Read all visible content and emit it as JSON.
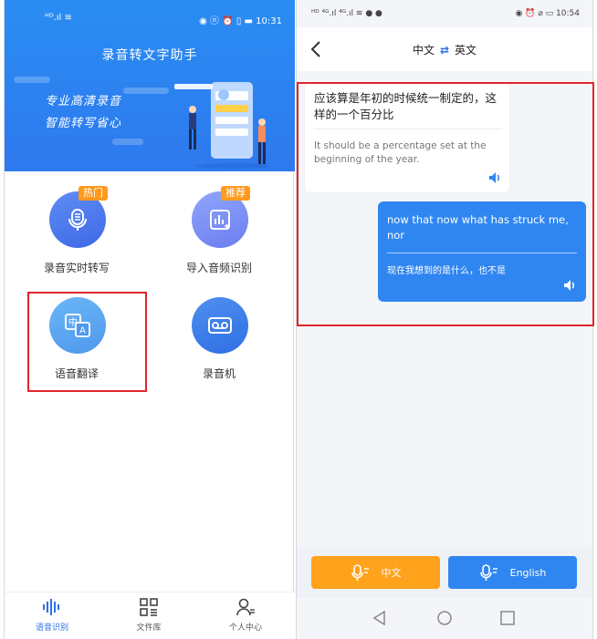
{
  "left_phone": {
    "status_left": "ᴴᴰ.ıl ≋",
    "status_right": "◉ ⓝ ⏰ ▯ ▬ 10:31",
    "app_title": "录音转文字助手",
    "slogan_line1": "专业高清录音",
    "slogan_line2": "智能转写省心",
    "features": [
      {
        "label": "录音实时转写",
        "badge": "热门",
        "icon": "mic-doc-icon"
      },
      {
        "label": "导入音频识别",
        "badge": "推荐",
        "icon": "chart-import-icon"
      },
      {
        "label": "语音翻译",
        "badge": "",
        "icon": "translate-icon"
      },
      {
        "label": "录音机",
        "badge": "",
        "icon": "cassette-icon"
      }
    ],
    "tabs": [
      {
        "label": "语音识别",
        "icon": "waveform-icon",
        "active": true
      },
      {
        "label": "文件库",
        "icon": "grid-list-icon",
        "active": false
      },
      {
        "label": "个人中心",
        "icon": "user-icon",
        "active": false
      }
    ],
    "colors": {
      "brand": "#2e79ee",
      "badge": "#ff9a1f",
      "highlight": "#e0262b"
    }
  },
  "right_phone": {
    "status_left": "ᴴᴰ ⁴ᴳ.ıl ⁴ᴳ.ıl ≋ ● ●",
    "status_right": "◉ ⏰ ⌀ ▭ 10:54",
    "header": {
      "source_lang": "中文",
      "swap_icon": "⇄",
      "target_lang": "英文"
    },
    "messages": [
      {
        "side": "left",
        "text": "应该算是年初的时候统一制定的，这样的一个百分比",
        "translation": "It should be a percentage set at the beginning of the year."
      },
      {
        "side": "right",
        "text": "now that now what has struck me, nor",
        "translation": "现在我想到的是什么，也不是"
      }
    ],
    "buttons": {
      "zh_label": "中文",
      "en_label": "English"
    },
    "colors": {
      "zh_button": "#ffa21c",
      "en_button": "#2f86f0"
    }
  }
}
